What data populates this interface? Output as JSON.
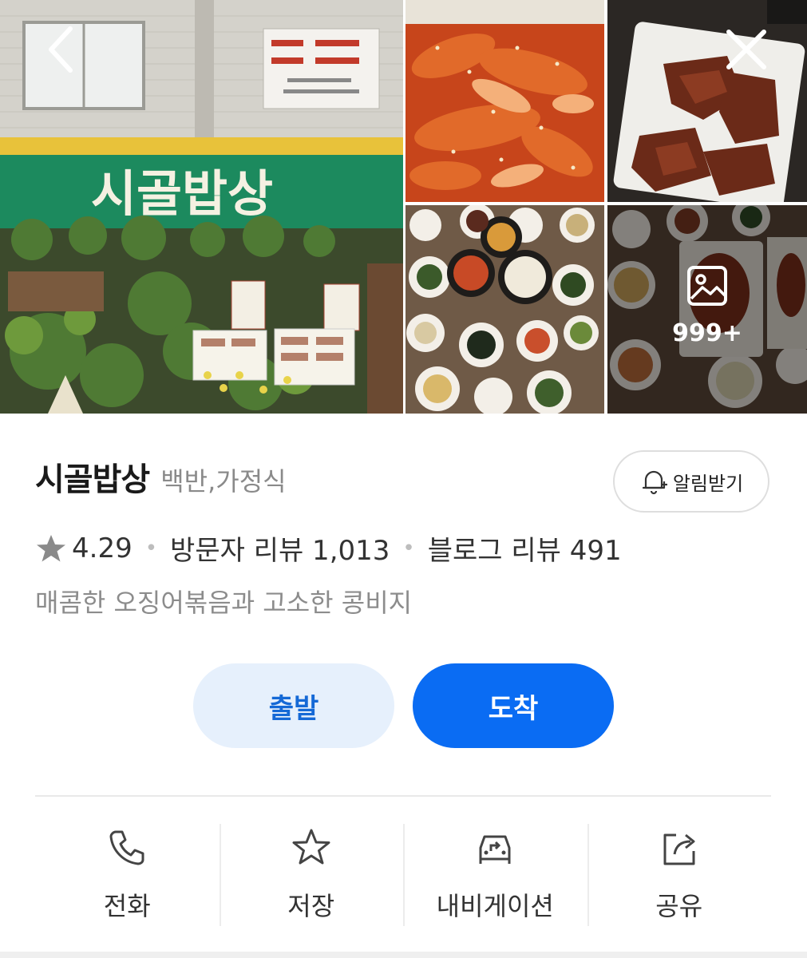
{
  "gallery": {
    "storefront_sign": "시골밥상",
    "more_count": "999+"
  },
  "place": {
    "name": "시골밥상",
    "category": "백반,가정식",
    "notify_label": "알림받기",
    "rating": "4.29",
    "visitor_reviews": "방문자 리뷰 1,013",
    "blog_reviews": "블로그 리뷰 491",
    "tagline": "매콤한 오징어볶음과 고소한 콩비지"
  },
  "route": {
    "depart_label": "출발",
    "arrive_label": "도착"
  },
  "actions": [
    {
      "label": "전화",
      "icon": "phone-icon"
    },
    {
      "label": "저장",
      "icon": "star-outline-icon"
    },
    {
      "label": "내비게이션",
      "icon": "car-navigation-icon"
    },
    {
      "label": "공유",
      "icon": "share-icon"
    }
  ],
  "colors": {
    "primary": "#0a6cf3",
    "primary_light": "#e6f0fc",
    "primary_text": "#1569d6",
    "muted_text": "#8c8c8c"
  }
}
